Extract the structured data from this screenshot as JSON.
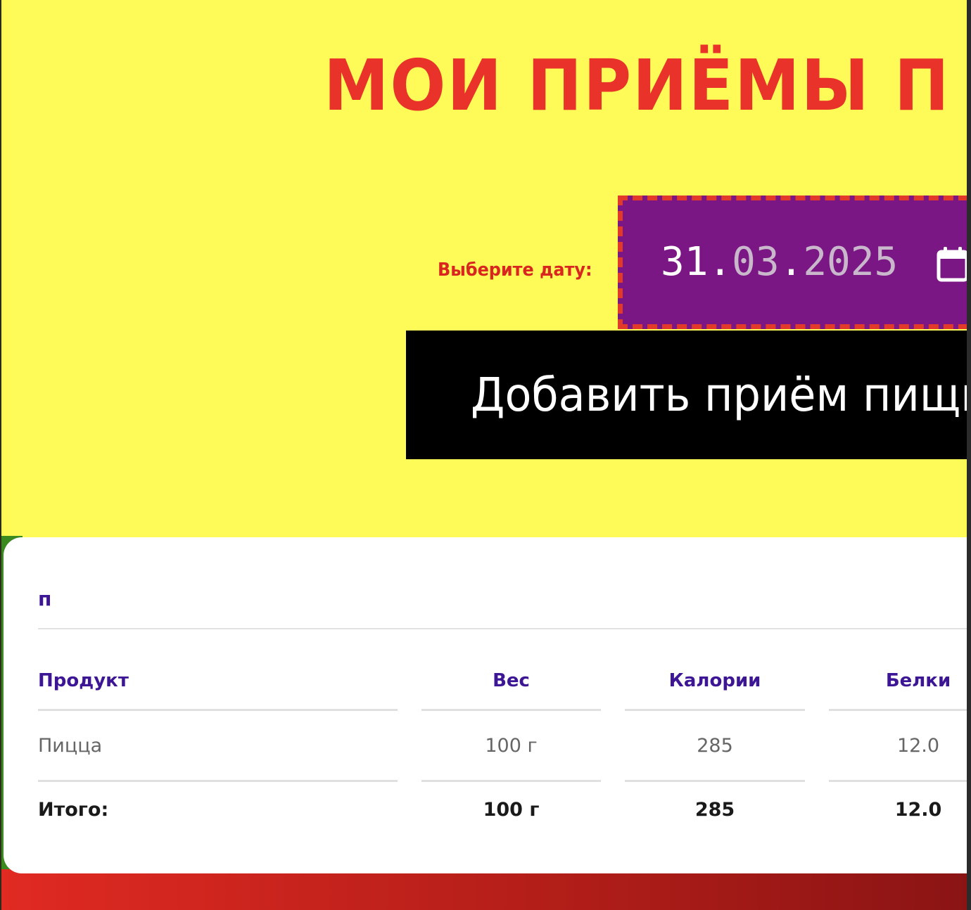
{
  "header": {
    "title": "МОИ ПРИЁМЫ П"
  },
  "date_picker": {
    "label": "Выберите дату:",
    "day": "31",
    "month": "03",
    "year": "2025",
    "icon": "calendar-icon"
  },
  "add_button": {
    "label": "Добавить приём пищи"
  },
  "meal": {
    "name": "п",
    "columns": [
      "Продукт",
      "Вес",
      "Калории",
      "Белки"
    ],
    "rows": [
      [
        "Пицца",
        "100 г",
        "285",
        "12.0"
      ]
    ],
    "total": [
      "Итого:",
      "100 г",
      "285",
      "12.0"
    ]
  },
  "colors": {
    "page_background": "#fefa57",
    "title": "#e8322a",
    "date_input_background": "#7a1784",
    "date_input_border": "#e23a2a",
    "button_background": "#000000",
    "table_header": "#3d1696",
    "bottom_bar": "#c0201a"
  }
}
